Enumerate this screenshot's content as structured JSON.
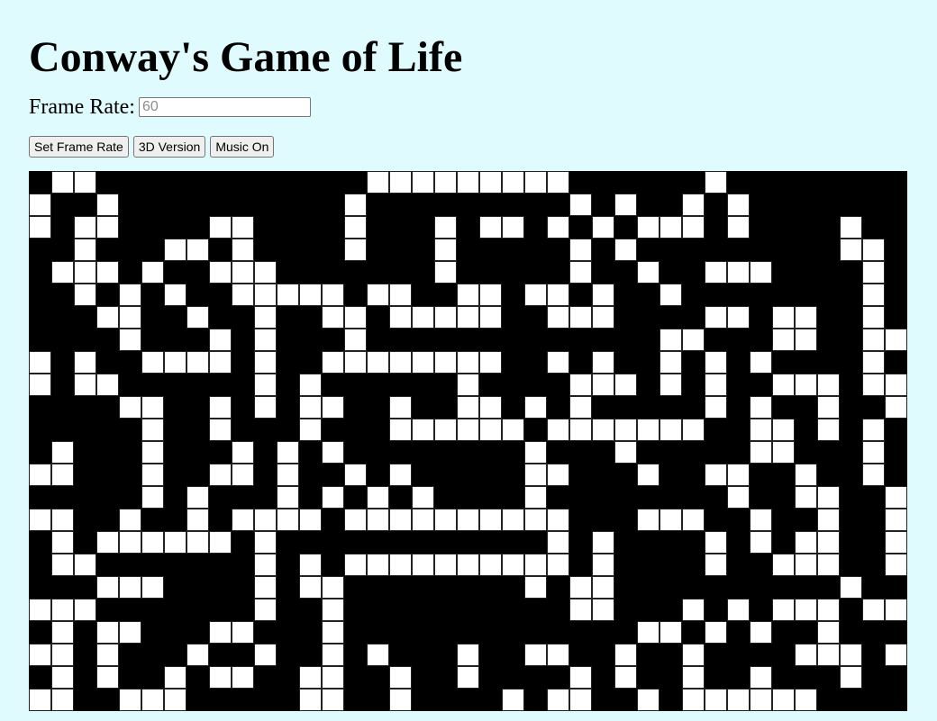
{
  "title": "Conway's Game of Life",
  "frame_rate": {
    "label": "Frame Rate:",
    "placeholder": "60",
    "value": ""
  },
  "buttons": {
    "set_frame_rate": "Set Frame Rate",
    "version_3d": "3D Version",
    "music": "Music On"
  },
  "colors": {
    "background": "#e0fbfd",
    "alive": "#ffffff",
    "dead": "#000000"
  },
  "board": {
    "cols": 39,
    "rows": 24,
    "cells": [
      "011000000000000111111111000000100000000000",
      "100100000000001000000000101001010000000110",
      "101100001100001000101101010111010000100100",
      "001000110100001000100000101000000000110100",
      "011101001110000000100000100100111000010101",
      "001010100111110110011011010010000000010101",
      "000110010010011011111001110000110110010101",
      "000010001010001000000000000011000110011001",
      "101001111010011111111001010010101000010100",
      "101100000010100000010000111010100111011010",
      "000011001010110010011010100000101001001010",
      "000001001000100011111101111111001101010010",
      "010001000101010000000010001000001100010000",
      "110001001101001010000011000100110010010111",
      "000001010001010101000010000000010011001000",
      "110010010111101111111111000111001001001000",
      "010111111010000000000001010000101011001010",
      "011000000010101111111111010000100111001000",
      "000111000010110000000010110000000000100100",
      "111000000010010000000000110001010111011101",
      "010110001100010000000000000110101001000000",
      "110100010010010100010011001001000011101101",
      "010100101100110010010000101001001000100101",
      "110011100000110010000101100101111110000000"
    ]
  }
}
